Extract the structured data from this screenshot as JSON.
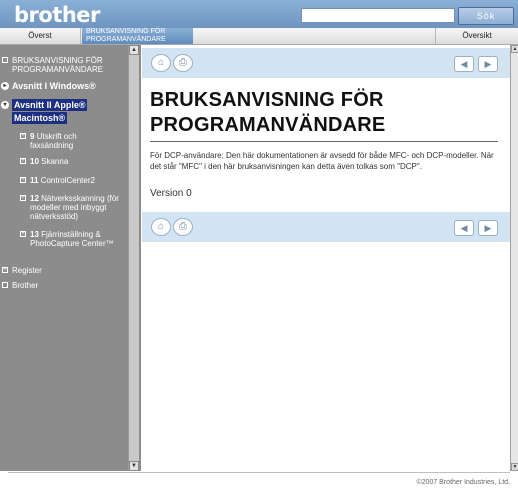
{
  "header": {
    "logo_text": "brother",
    "search_placeholder": "",
    "search_button": "Sök"
  },
  "nav": {
    "overst": "Överst",
    "current_line1": "BRUKSANVISNING FÖR",
    "current_line2": "PROGRAMANVÄNDARE",
    "oversikt": "Översikt"
  },
  "sidebar": {
    "items": [
      {
        "label": "BRUKSANVISNING FÖR PROGRAMANVÄNDARE"
      },
      {
        "label": "Avsnitt I Windows®"
      },
      {
        "label_line1": "Avsnitt II Apple®",
        "label_line2": "Macintosh®"
      },
      {
        "num": "9",
        "label": "Utskrift och faxsändning"
      },
      {
        "num": "10",
        "label": "Skanna"
      },
      {
        "num": "11",
        "label": "ControlCenter2"
      },
      {
        "num": "12",
        "label": "Nätverksskanning (för modeller med inbyggt nätverksstöd)"
      },
      {
        "num": "13",
        "label": "Fjärrinställning & PhotoCapture Center™"
      },
      {
        "label": "Register"
      },
      {
        "label": "Brother"
      }
    ]
  },
  "main": {
    "title": "BRUKSANVISNING FÖR PROGRAMANVÄNDARE",
    "description": "För DCP-användare; Den här dokumentationen är avsedd för både MFC- och DCP-modeller. När det står \"MFC\" i den här bruksanvisningen kan detta även tolkas som \"DCP\".",
    "version": "Version 0"
  },
  "footer": {
    "copyright": "©2007 Brother Industries, Ltd."
  },
  "icons": {
    "home": "home-icon",
    "print": "print-icon",
    "prev": "prev-arrow-icon",
    "next": "next-arrow-icon"
  },
  "colors": {
    "header": "#7aa0cb",
    "sidebar": "#8c8c8c",
    "toolbar": "#d2e3f2",
    "selected": "#1d2f80"
  }
}
